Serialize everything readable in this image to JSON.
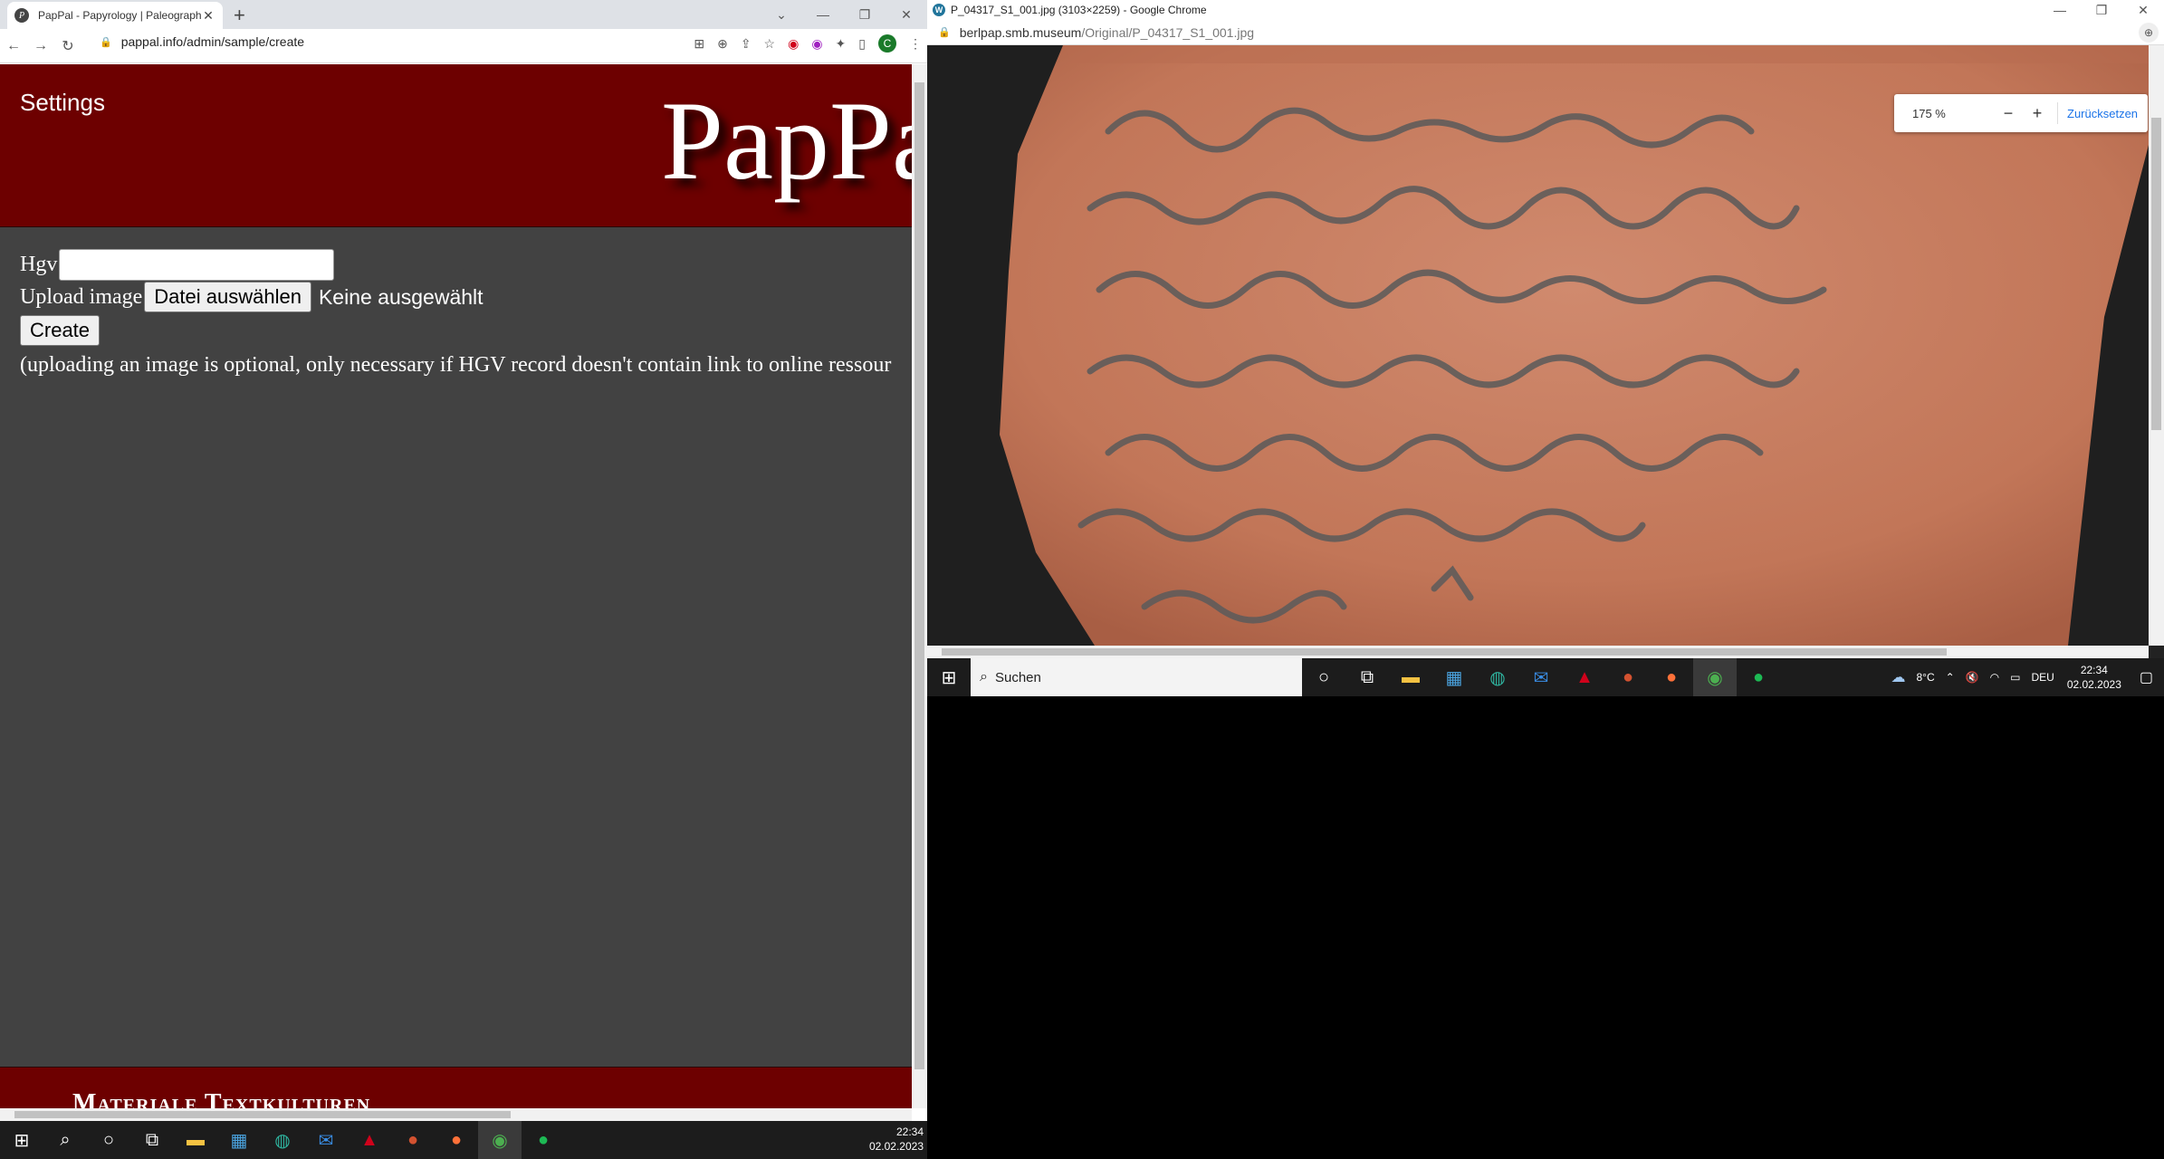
{
  "left_browser": {
    "tab_title": "PapPal - Papyrology | Paleograph",
    "tab_favicon": "P",
    "url": "pappal.info/admin/sample/create",
    "profile_initial": "C"
  },
  "page": {
    "settings_label": "Settings",
    "logo_text": "PapPal",
    "hgv_label": "Hgv",
    "hgv_value": "",
    "upload_label": "Upload image",
    "file_button_label": "Datei auswählen",
    "file_status": "Keine ausgewählt",
    "create_label": "Create",
    "note": "(uploading an image is optional, only necessary if HGV record doesn't contain link to online ressour",
    "footer_title": "Materiale Textkulturen"
  },
  "left_taskbar": {
    "time": "22:34",
    "date": "02.02.2023"
  },
  "right_browser": {
    "window_title": "P_04317_S1_001.jpg (3103×2259) - Google Chrome",
    "url_domain": "berlpap.smb.museum",
    "url_path": "/Original/P_04317_S1_001.jpg",
    "zoom_value": "175 %",
    "zoom_minus": "−",
    "zoom_plus": "+",
    "zoom_reset": "Zurücksetzen"
  },
  "right_taskbar": {
    "search_placeholder": "Suchen",
    "weather": "8°C",
    "language": "DEU",
    "time": "22:34",
    "date": "02.02.2023"
  },
  "colors": {
    "header_red": "#6d0000",
    "page_bg": "#424242",
    "ostracon": "#c97a60"
  }
}
